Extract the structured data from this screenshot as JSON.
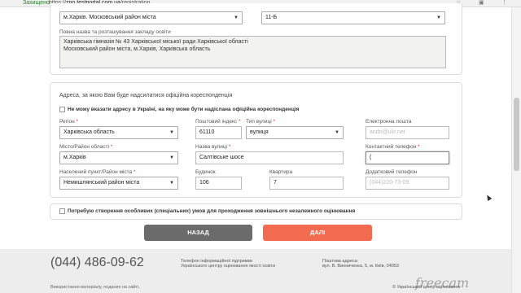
{
  "browser": {
    "secure_label": "Захищено",
    "url_prefix": "https://",
    "url_host": "zno.testportal.com.ua",
    "url_path": "/registration"
  },
  "school": {
    "city_select": "м.Харків. Московський район міста",
    "school_select": "11-Б",
    "full_name_label": "Повна назва та розташування закладу освіти",
    "full_name_line1": "Харківська гімназія № 43 Харківської міської ради Харківської області",
    "full_name_line2": "Московський район міста, м.Харків, Харківська область"
  },
  "address": {
    "heading": "Адреса, за якою Вам буде надсилатися офіційна кореспонденція",
    "foreign_checkbox_label": "Не можу вказати адресу в Україні, на яку може бути надіслана офіційна кореспонденція",
    "region_label": "Регіон",
    "region_value": "Харківська область",
    "postcode_label": "Поштовий індекс",
    "postcode_value": "61110",
    "street_type_label": "Тип вулиці",
    "street_type_value": "вулиця",
    "email_label": "Електронна пошта",
    "email_placeholder": "andri@ukr.net",
    "district_label": "Місто/Район області",
    "district_value": "м.Харків",
    "street_label": "Назва вулиці",
    "street_value": "Салтівське шосе",
    "contact_phone_label": "Контактний телефон",
    "contact_phone_value": "(",
    "settlement_label": "Населений пункт/Район міста",
    "settlement_value": "Немишлянський район міста",
    "building_label": "Будинок",
    "building_value": "106",
    "apartment_label": "Квартира",
    "apartment_value": "7",
    "extra_phone_label": "Додатковий телефон",
    "extra_phone_placeholder": "(044)220-73-09",
    "required_mark": "*"
  },
  "special": {
    "checkbox_label": "Потребую створення особливих (спеціальних) умов для проходження зовнішнього незалежного оцінювання"
  },
  "buttons": {
    "back": "НАЗАД",
    "next": "ДАЛІ"
  },
  "footer": {
    "phone": "(044) 486-09-62",
    "info_line1": "Телефон інформаційної підтримки",
    "info_line2": "Українського центру оцінювання якості освіти",
    "address_line1": "Поштова адреса:",
    "address_line2": "вул. В. Винниченка, 5, м. Київ, 04053",
    "copyright": "Використання матеріалу, поданих на сайті,",
    "copyright_right": "© Український центр оцінювання",
    "watermark": "freecam"
  }
}
